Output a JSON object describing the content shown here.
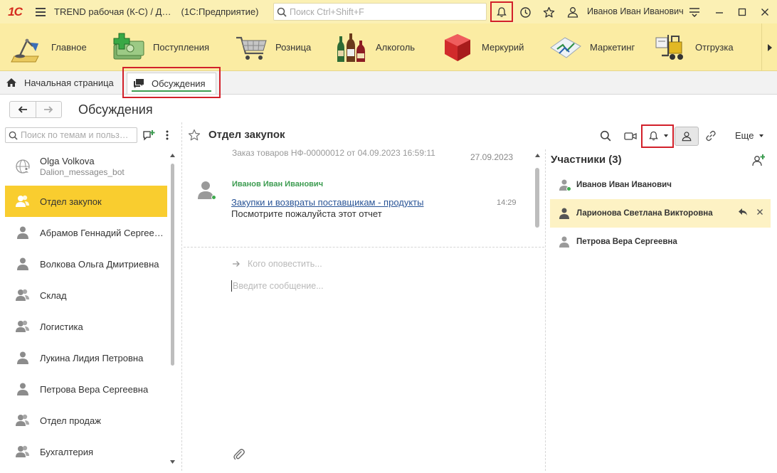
{
  "titlebar": {
    "logo": "1С",
    "app_title": "TREND рабочая (К-С) / Д…",
    "platform": "(1С:Предприятие)",
    "search_placeholder": "Поиск Ctrl+Shift+F",
    "user_name": "Иванов Иван Иванович",
    "icons": [
      "menu-icon",
      "search-icon",
      "bell-icon",
      "history-icon",
      "star-icon",
      "users-icon",
      "settings-icon",
      "minimize-icon",
      "maximize-icon",
      "close-icon"
    ]
  },
  "sections": [
    {
      "label": "Главное",
      "icon": "desk-lamp-icon"
    },
    {
      "label": "Поступления",
      "icon": "money-plus-icon"
    },
    {
      "label": "Розница",
      "icon": "shopping-cart-icon"
    },
    {
      "label": "Алкоголь",
      "icon": "bottles-icon"
    },
    {
      "label": "Меркурий",
      "icon": "red-cube-icon"
    },
    {
      "label": "Маркетинг",
      "icon": "marketing-chart-icon"
    },
    {
      "label": "Отгрузка",
      "icon": "forklift-icon"
    }
  ],
  "tabs": {
    "home": "Начальная страница",
    "active": "Обсуждения"
  },
  "page": {
    "title": "Обсуждения"
  },
  "left": {
    "search_placeholder": "Поиск по темам и польз…",
    "conversations": [
      {
        "name": "Olga Volkova",
        "sub": "Dalion_messages_bot",
        "icon": "globe-user-icon"
      },
      {
        "name": "Отдел закупок",
        "active": true,
        "icon": "group-icon"
      },
      {
        "name": "Абрамов Геннадий Сергеевич",
        "icon": "user-icon"
      },
      {
        "name": "Волкова Ольга Дмитриевна",
        "icon": "user-icon"
      },
      {
        "name": "Склад",
        "icon": "group-icon"
      },
      {
        "name": "Логистика",
        "icon": "group-icon"
      },
      {
        "name": "Лукина Лидия Петровна",
        "icon": "user-icon"
      },
      {
        "name": "Петрова Вера Сергеевна",
        "icon": "user-icon"
      },
      {
        "name": "Отдел продаж",
        "icon": "group-icon"
      },
      {
        "name": "Бухгалтерия",
        "icon": "group-icon"
      }
    ]
  },
  "chat": {
    "title": "Отдел закупок",
    "more_label": "Еще",
    "previous_message": "Заказ товаров НФ-00000012 от 04.09.2023 16:59:11",
    "date": "27.09.2023",
    "message": {
      "author": "Иванов Иван Иванович",
      "link": "Закупки и возвраты поставщикам - продукты",
      "text": "Посмотрите пожалуйста этот отчет",
      "time": "14:29"
    },
    "notify_placeholder": "Кого оповестить...",
    "compose_placeholder": "Введите сообщение..."
  },
  "participants": {
    "title": "Участники (3)",
    "items": [
      {
        "name": "Иванов Иван Иванович",
        "online": true
      },
      {
        "name": "Ларионова Светлана Викторовна",
        "highlight": true
      },
      {
        "name": "Петрова Вера Сергеевна"
      }
    ]
  },
  "colors": {
    "titlebar": "#fbf0b4",
    "sections_panel": "#fbeca3",
    "active_item": "#f9cd2f",
    "accent_green": "#3d9c51",
    "link": "#2a5597",
    "highlight_frame": "#d2202a"
  }
}
